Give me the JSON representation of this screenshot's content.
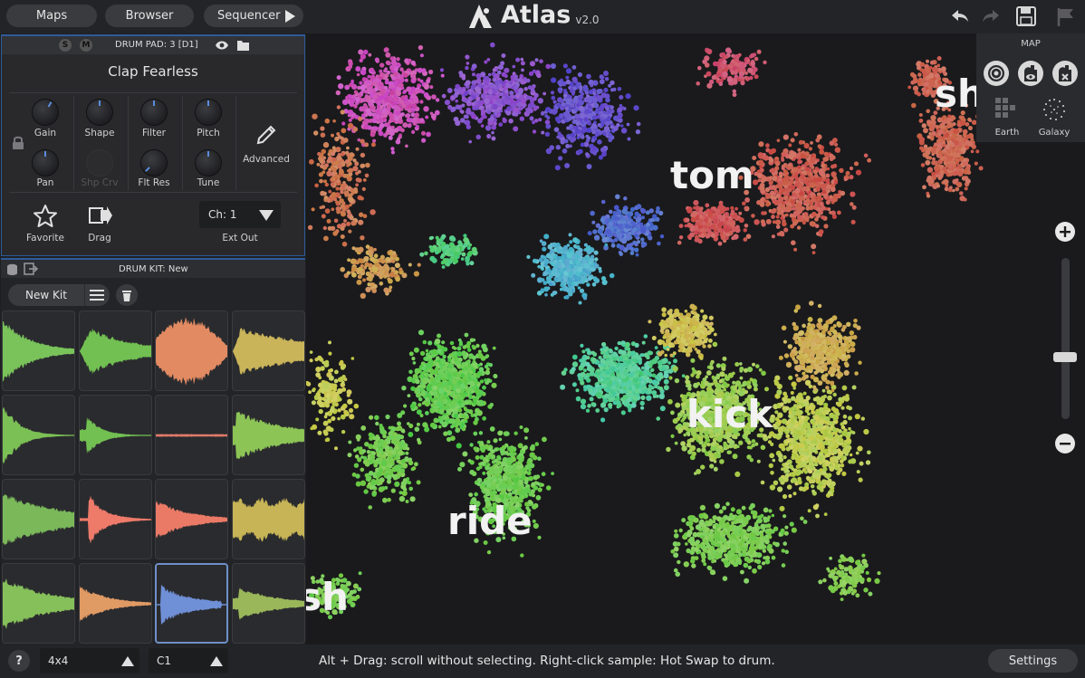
{
  "topbar": {
    "maps_label": "Maps",
    "browser_label": "Browser",
    "sequencer_label": "Sequencer",
    "app_name": "Atlas",
    "version": "v2.0",
    "icons": [
      "undo-icon",
      "redo-icon",
      "save-icon",
      "flag-icon"
    ]
  },
  "drum_pad": {
    "solo": "S",
    "mute": "M",
    "title": "DRUM PAD: 3 [D1]",
    "sample_name": "Clap Fearless",
    "knobs": [
      {
        "label": "Gain",
        "enabled": true
      },
      {
        "label": "Shape",
        "enabled": true
      },
      {
        "label": "Filter",
        "enabled": true
      },
      {
        "label": "Pitch",
        "enabled": true
      },
      {
        "label": "Pan",
        "enabled": true
      },
      {
        "label": "Shp Crv",
        "enabled": false
      },
      {
        "label": "Flt Res",
        "enabled": true
      },
      {
        "label": "Tune",
        "enabled": true
      }
    ],
    "advanced_label": "Advanced",
    "favorite_label": "Favorite",
    "drag_label": "Drag",
    "channel_value": "Ch: 1",
    "ext_out_label": "Ext Out"
  },
  "drum_kit": {
    "title": "DRUM KIT: New",
    "new_kit_label": "New Kit",
    "pads": [
      {
        "color": "#79c35a"
      },
      {
        "color": "#72c052"
      },
      {
        "color": "#e28a62"
      },
      {
        "color": "#c9b45a"
      },
      {
        "color": "#7bc055"
      },
      {
        "color": "#72c052"
      },
      {
        "color": "#e07a6a"
      },
      {
        "color": "#8cc456"
      },
      {
        "color": "#7ab85a"
      },
      {
        "color": "#ee7a6a"
      },
      {
        "color": "#ea7a66"
      },
      {
        "color": "#c7b456"
      },
      {
        "color": "#86c05a"
      },
      {
        "color": "#e09a64"
      },
      {
        "color": "#6f8fd6",
        "selected": true
      },
      {
        "color": "#9ab85a"
      }
    ]
  },
  "map": {
    "labels": [
      "tom",
      "kick",
      "ride",
      "sh",
      "sh"
    ],
    "panel_title": "MAP",
    "styles": [
      "Earth",
      "Galaxy"
    ]
  },
  "bottombar": {
    "help": "?",
    "grid_value": "4x4",
    "note_value": "C1",
    "status_text": "Alt + Drag: scroll without selecting. Right-click sample: Hot Swap to drum.",
    "settings_label": "Settings"
  }
}
